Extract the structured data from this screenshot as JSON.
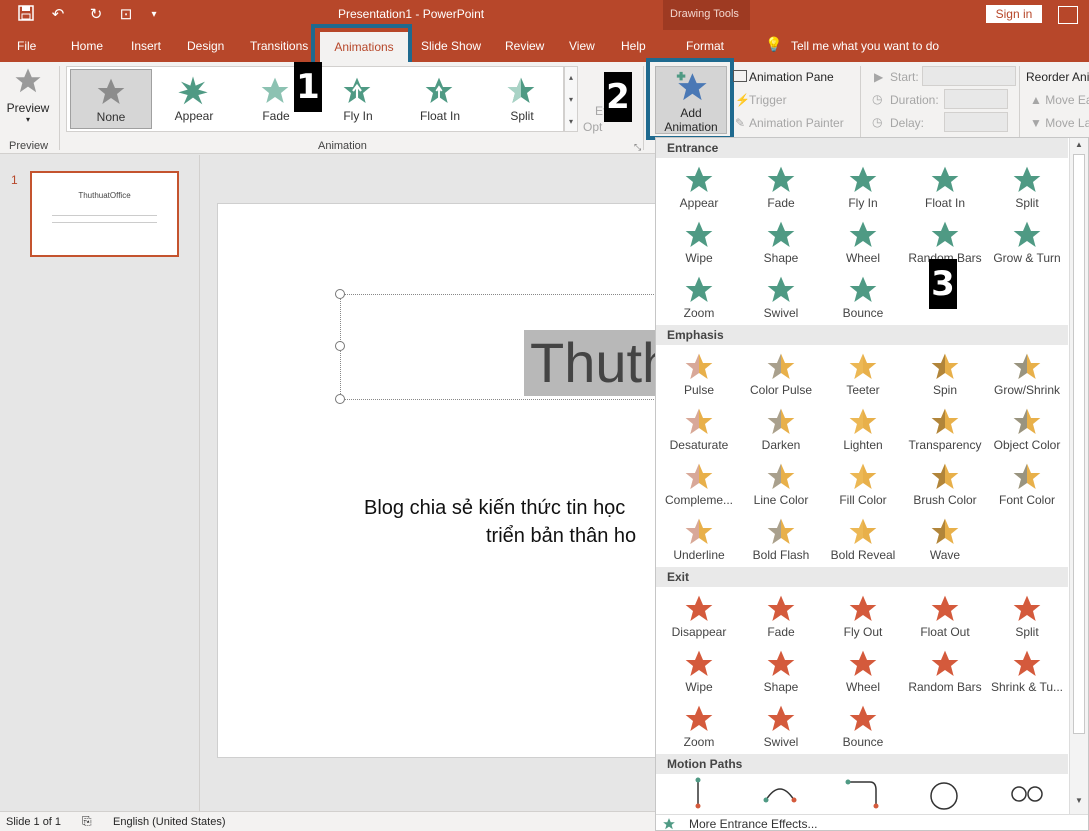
{
  "window": {
    "title": "Presentation1 - PowerPoint",
    "context_title": "Drawing Tools",
    "signin": "Sign in"
  },
  "tabs": {
    "file": "File",
    "home": "Home",
    "insert": "Insert",
    "design": "Design",
    "transitions": "Transitions",
    "animations": "Animations",
    "slideshow": "Slide Show",
    "review": "Review",
    "view": "View",
    "help": "Help",
    "format": "Format",
    "tellme": "Tell me what you want to do"
  },
  "ribbon": {
    "preview_label": "Preview",
    "preview_group": "Preview",
    "animation_group": "Animation",
    "gallery": [
      "None",
      "Appear",
      "Fade",
      "Fly In",
      "Float In",
      "Split"
    ],
    "effect_options_a": "Ef",
    "effect_options_b": "Opt",
    "add_animation_line1": "Add",
    "add_animation_line2": "Animation",
    "animation_pane": "Animation Pane",
    "trigger": "Trigger",
    "animation_painter": "Animation Painter",
    "start": "Start:",
    "duration": "Duration:",
    "delay": "Delay:",
    "reorder": "Reorder Ani",
    "move_earlier": "Move Ea",
    "move_later": "Move La"
  },
  "callouts": {
    "one": "1",
    "two": "2",
    "three": "3"
  },
  "slides": {
    "number": "1",
    "thumb_title": "ThuthuatOffice"
  },
  "slide": {
    "title_visible": "Thuth",
    "sub_line1": "Blog chia sẻ kiến thức tin học",
    "sub_line2": "triển bản thân ho"
  },
  "dropdown": {
    "sections": {
      "entrance": "Entrance",
      "emphasis": "Emphasis",
      "exit": "Exit",
      "motion": "Motion Paths"
    },
    "entrance": [
      "Appear",
      "Fade",
      "Fly In",
      "Float In",
      "Split",
      "Wipe",
      "Shape",
      "Wheel",
      "Random Bars",
      "Grow & Turn",
      "Zoom",
      "Swivel",
      "Bounce"
    ],
    "emphasis": [
      "Pulse",
      "Color Pulse",
      "Teeter",
      "Spin",
      "Grow/Shrink",
      "Desaturate",
      "Darken",
      "Lighten",
      "Transparency",
      "Object Color",
      "Compleme...",
      "Line Color",
      "Fill Color",
      "Brush Color",
      "Font Color",
      "Underline",
      "Bold Flash",
      "Bold Reveal",
      "Wave"
    ],
    "exit": [
      "Disappear",
      "Fade",
      "Fly Out",
      "Float Out",
      "Split",
      "Wipe",
      "Shape",
      "Wheel",
      "Random Bars",
      "Shrink & Tu...",
      "Zoom",
      "Swivel",
      "Bounce"
    ],
    "more_entrance": "More Entrance Effects..."
  },
  "status": {
    "slide_of": "Slide 1 of 1",
    "language": "English (United States)"
  },
  "colors": {
    "accent": "#b7472a",
    "entrance": "#4f9a84",
    "emphasis": "#e8b04a",
    "exit": "#d45a3c",
    "callout_border": "#1f6a8f"
  },
  "icons": {
    "save": "save-icon",
    "undo": "undo-icon",
    "redo": "redo-icon",
    "star": "star-icon",
    "lightbulb": "lightbulb-icon"
  }
}
